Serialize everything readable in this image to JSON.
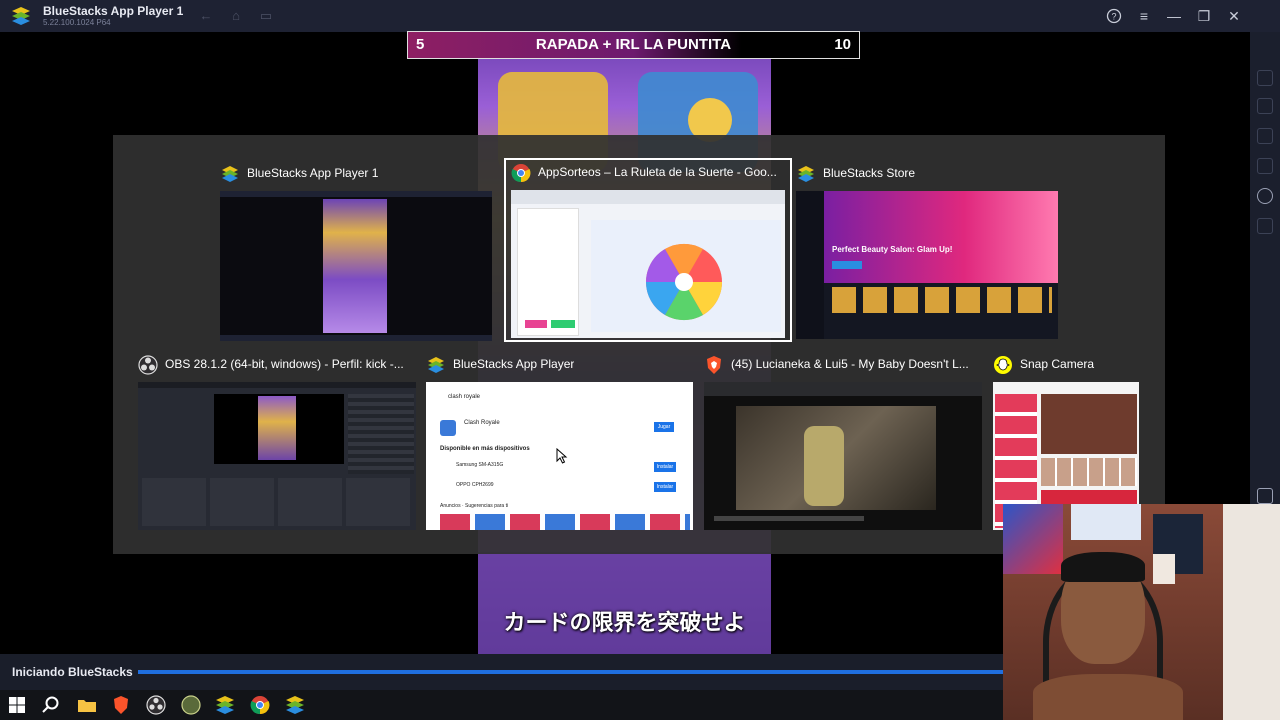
{
  "titlebar": {
    "app_title": "BlueStacks App Player 1",
    "version": "5.22.100.1024  P64",
    "icons": [
      "back-icon",
      "home-icon",
      "multi-instance-icon",
      "help-icon",
      "menu-icon",
      "minimize-icon",
      "restore-icon",
      "close-icon"
    ]
  },
  "scoreboard": {
    "left_number": "5",
    "title": "RAPADA + IRL LA PUNTITA",
    "right_number": "10"
  },
  "game": {
    "caption": "カードの限界を突破せよ"
  },
  "switcher": {
    "windows": [
      {
        "title": "BlueStacks App Player 1",
        "icon": "bluestacks-icon",
        "selected": false
      },
      {
        "title": "AppSorteos – La Ruleta de la Suerte - Goo...",
        "icon": "chrome-icon",
        "selected": true
      },
      {
        "title": "BlueStacks Store",
        "icon": "bluestacks-icon",
        "selected": false
      },
      {
        "title": "OBS 28.1.2 (64-bit, windows) - Perfil: kick -...",
        "icon": "obs-icon",
        "selected": false
      },
      {
        "title": "BlueStacks App Player",
        "icon": "bluestacks-icon",
        "selected": false
      },
      {
        "title": "(45) Lucianeka & Lui5 - My Baby Doesn't L...",
        "icon": "brave-icon",
        "selected": false
      },
      {
        "title": "Snap Camera",
        "icon": "snap-camera-icon",
        "selected": false
      }
    ],
    "store_banner": "Perfect Beauty Salon: Glam Up!",
    "playstore_search": "clash royale",
    "playstore_app": "Clash Royale",
    "playstore_install": "Jugar",
    "playstore_section": "Disponible en más dispositivos",
    "device_1": "Samsung SM-A315G",
    "device_2": "OPPO CPH2699",
    "device_button": "Instalar",
    "playstore_suggest": "Anuncios · Sugerencias para ti"
  },
  "status": {
    "label": "Iniciando BlueStacks",
    "progress": 1.0
  },
  "taskbar": {
    "icons": [
      "windows-start-icon",
      "search-icon",
      "file-explorer-icon",
      "brave-icon",
      "obs-icon",
      "app-icon",
      "bluestacks-icon",
      "chrome-icon",
      "bluestacks-icon"
    ]
  },
  "colors": {
    "titlebar": "#1e2233",
    "accent": "#1f6fe0",
    "score_magenta": "#8e1f63"
  }
}
